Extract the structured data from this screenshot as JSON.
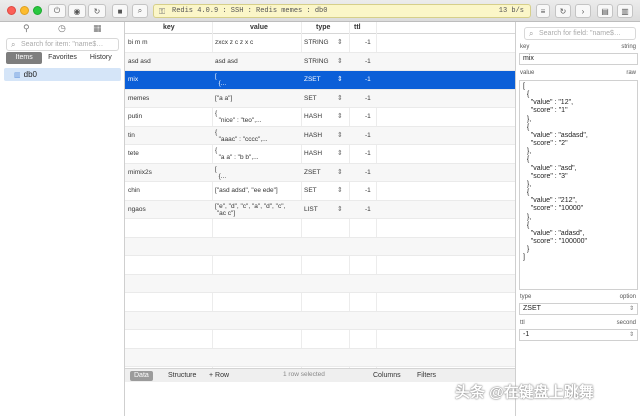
{
  "toolbar": {
    "address": "Redis 4.0.9 : SSH : Redis memes : db0",
    "rate": "13 b/s",
    "lock_glyph": "🔒"
  },
  "sidebar": {
    "search_placeholder": "Search for item: \"name$…",
    "tabs": [
      {
        "label": "Items",
        "active": true
      },
      {
        "label": "Favorites",
        "active": false
      },
      {
        "label": "History",
        "active": false
      }
    ],
    "databases": [
      {
        "label": "db0"
      }
    ]
  },
  "table": {
    "columns": [
      "key",
      "value",
      "type",
      "ttl"
    ],
    "rows": [
      {
        "key": "bi m m",
        "value": "zxcx z c z x c",
        "type": "STRING",
        "ttl": "-1"
      },
      {
        "key": "asd asd",
        "value": "asd asd",
        "type": "STRING",
        "ttl": "-1"
      },
      {
        "key": "mix",
        "value": "[\n  {...",
        "type": "ZSET",
        "ttl": "-1",
        "selected": true
      },
      {
        "key": "memes",
        "value": "[\"a a\"]",
        "type": "SET",
        "ttl": "-1"
      },
      {
        "key": "putin",
        "value": "{\n  \"nice\" : \"teo\",...",
        "type": "HASH",
        "ttl": "-1"
      },
      {
        "key": "tin",
        "value": "{\n  \"aaac\" : \"cccc\",...",
        "type": "HASH",
        "ttl": "-1"
      },
      {
        "key": "tete",
        "value": "{\n  \"a a\" : \"b b\",...",
        "type": "HASH",
        "ttl": "-1"
      },
      {
        "key": "mimix2s",
        "value": "[\n  {...",
        "type": "ZSET",
        "ttl": "-1"
      },
      {
        "key": "chin",
        "value": "[\"asd adsd\", \"ee ede\"]",
        "type": "SET",
        "ttl": "-1"
      },
      {
        "key": "ngaos",
        "value": "[\"e\", \"d\", \"c\", \"a\", \"d\", \"c\",\n \"ac c\"]",
        "type": "LIST",
        "ttl": "-1"
      }
    ]
  },
  "bottombar": {
    "data_label": "Data",
    "structure_label": "Structure",
    "add_row_label": "+  Row",
    "status": "1 row selected",
    "columns_label": "Columns",
    "filters_label": "Filters"
  },
  "detail": {
    "search_placeholder": "Search for field: \"name$…",
    "key_label": "key",
    "key_type_label": "string",
    "key_value": "mix",
    "value_label": "value",
    "value_format_label": "raw",
    "raw_value": "[\n  {\n    \"value\" : \"12\",\n    \"score\" : \"1\"\n  },\n  {\n    \"value\" : \"asdasd\",\n    \"score\" : \"2\"\n  },\n  {\n    \"value\" : \"asd\",\n    \"score\" : \"3\"\n  },\n  {\n    \"value\" : \"212\",\n    \"score\" : \"10000\"\n  },\n  {\n    \"value\" : \"adasd\",\n    \"score\" : \"100000\"\n  }\n]",
    "type_label": "type",
    "type_option_label": "option",
    "type_value": "ZSET",
    "ttl_label": "ttl",
    "ttl_unit_label": "second",
    "ttl_value": "-1"
  },
  "watermark": "头条 @在键盘上跳舞",
  "colors": {
    "selection": "#0b5fd8",
    "address_bg": "#fbf6c8",
    "sidebar_selected": "#d5e5f8"
  }
}
